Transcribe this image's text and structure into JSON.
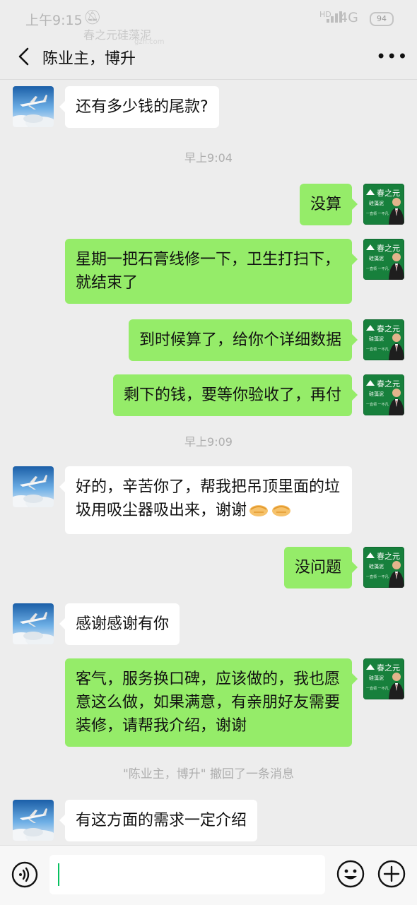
{
  "status_bar": {
    "time": "上午9:15",
    "network_hd": "HD",
    "network": "4G",
    "battery": "94",
    "watermark": "春之元硅藻泥",
    "watermark_url": "gzn.com"
  },
  "header": {
    "title": "陈业主，博升"
  },
  "messages": [
    {
      "kind": "in",
      "text": "还有多少钱的尾款?"
    },
    {
      "kind": "time",
      "text": "早上9:04"
    },
    {
      "kind": "out",
      "text": "没算"
    },
    {
      "kind": "out",
      "text": "星期一把石膏线修一下，卫生打扫下，就结束了"
    },
    {
      "kind": "out",
      "text": "到时候算了，给你个详细数据"
    },
    {
      "kind": "out",
      "text": "剩下的钱，要等你验收了，再付"
    },
    {
      "kind": "time",
      "text": "早上9:09"
    },
    {
      "kind": "in",
      "text": "好的，辛苦你了，帮我把吊顶里面的垃圾用吸尘器吸出来，谢谢"
    },
    {
      "kind": "out",
      "text": "没问题"
    },
    {
      "kind": "in",
      "text": "感谢感谢有你"
    },
    {
      "kind": "out",
      "text": "客气，服务换口碑，应该做的，我也愿意这么做，如果满意，有亲朋好友需要装修，请帮我介绍，谢谢"
    },
    {
      "kind": "system",
      "text": "\"陈业主，博升\" 撤回了一条消息"
    },
    {
      "kind": "in",
      "text": "有这方面的需求一定介绍"
    }
  ],
  "avatar_seller_text": {
    "brand": "春之元",
    "product": "硅藻泥",
    "slogan": "一直领 一不凡"
  },
  "colors": {
    "outgoing_bubble": "#95ec69",
    "incoming_bubble": "#ffffff",
    "background": "#ededed",
    "caret": "#07c160"
  },
  "icons": {
    "back": "chevron-left-icon",
    "more": "more-dots-icon",
    "voice": "voice-input-icon",
    "emoji": "emoji-icon",
    "plus": "plus-icon",
    "handshake": "handshake-emoji-icon"
  }
}
